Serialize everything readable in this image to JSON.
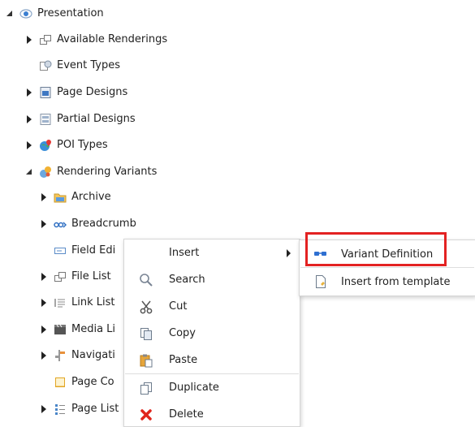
{
  "tree": {
    "root": {
      "label": "Presentation",
      "icon": "eye-icon"
    },
    "items": [
      {
        "label": "Available Renderings",
        "icon": "renderings-icon",
        "expandable": true
      },
      {
        "label": "Event Types",
        "icon": "event-types-icon",
        "expandable": false
      },
      {
        "label": "Page Designs",
        "icon": "page-designs-icon",
        "expandable": true
      },
      {
        "label": "Partial Designs",
        "icon": "partial-designs-icon",
        "expandable": true
      },
      {
        "label": "POI Types",
        "icon": "globe-icon",
        "expandable": true
      },
      {
        "label": "Rendering Variants",
        "icon": "rendering-variants-icon",
        "expandable": true,
        "expanded": true
      }
    ],
    "children": [
      {
        "label": "Archive",
        "icon": "folder-icon",
        "expandable": true
      },
      {
        "label": "Breadcrumb",
        "icon": "breadcrumb-icon",
        "expandable": true
      },
      {
        "label": "Field Edi",
        "icon": "field-editor-icon",
        "expandable": false
      },
      {
        "label": "File List",
        "icon": "file-list-icon",
        "expandable": true
      },
      {
        "label": "Link List",
        "icon": "link-list-icon",
        "expandable": true
      },
      {
        "label": "Media Li",
        "icon": "media-icon",
        "expandable": true
      },
      {
        "label": "Navigati",
        "icon": "navigation-icon",
        "expandable": true
      },
      {
        "label": "Page Co",
        "icon": "page-content-icon",
        "expandable": false
      },
      {
        "label": "Page List",
        "icon": "page-list-icon",
        "expandable": true
      }
    ]
  },
  "context_menu": {
    "items": [
      {
        "label": "Insert",
        "icon": "",
        "has_submenu": true
      },
      {
        "label": "Search",
        "icon": "search-icon"
      },
      {
        "label": "Cut",
        "icon": "scissors-icon"
      },
      {
        "label": "Copy",
        "icon": "copy-icon"
      },
      {
        "label": "Paste",
        "icon": "paste-icon"
      },
      {
        "label": "Duplicate",
        "icon": "duplicate-icon"
      },
      {
        "label": "Delete",
        "icon": "delete-icon"
      }
    ]
  },
  "submenu": {
    "items": [
      {
        "label": "Variant Definition",
        "icon": "variant-definition-icon",
        "highlighted": true
      },
      {
        "label": "Insert from template",
        "icon": "template-icon"
      }
    ]
  },
  "colors": {
    "highlight_border": "#e32222",
    "delete_icon": "#e0241b",
    "eye_icon": "#3b7fd1"
  }
}
